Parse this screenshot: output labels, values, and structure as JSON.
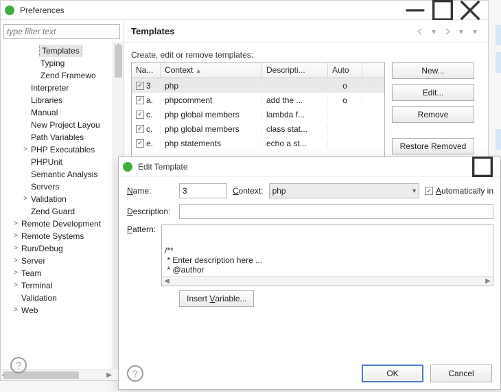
{
  "preferences": {
    "windowTitle": "Preferences",
    "filterPlaceholder": "type filter text",
    "tree": [
      {
        "label": "Templates",
        "level": 3,
        "selected": true
      },
      {
        "label": "Typing",
        "level": 3
      },
      {
        "label": "Zend Framewo",
        "level": 3
      },
      {
        "label": "Interpreter",
        "level": 2
      },
      {
        "label": "Libraries",
        "level": 2
      },
      {
        "label": "Manual",
        "level": 2
      },
      {
        "label": "New Project Layou",
        "level": 2
      },
      {
        "label": "Path Variables",
        "level": 2
      },
      {
        "label": "PHP Executables",
        "level": 2,
        "expander": ">"
      },
      {
        "label": "PHPUnit",
        "level": 2
      },
      {
        "label": "Semantic Analysis",
        "level": 2
      },
      {
        "label": "Servers",
        "level": 2
      },
      {
        "label": "Validation",
        "level": 2,
        "expander": ">"
      },
      {
        "label": "Zend Guard",
        "level": 2
      },
      {
        "label": "Remote Development",
        "level": 1,
        "expander": ">"
      },
      {
        "label": "Remote Systems",
        "level": 1,
        "expander": ">"
      },
      {
        "label": "Run/Debug",
        "level": 1,
        "expander": ">"
      },
      {
        "label": "Server",
        "level": 1,
        "expander": ">"
      },
      {
        "label": "Team",
        "level": 1,
        "expander": ">"
      },
      {
        "label": "Terminal",
        "level": 1,
        "expander": ">"
      },
      {
        "label": "Validation",
        "level": 1
      },
      {
        "label": "Web",
        "level": 1,
        "expander": ">"
      }
    ],
    "panel": {
      "title": "Templates",
      "description": "Create, edit or remove templates:",
      "columns": {
        "name": "Na...",
        "context": "Context",
        "descr": "Descripti...",
        "auto": "Auto"
      },
      "sortIndicator": "▲",
      "rows": [
        {
          "checked": true,
          "name": "3",
          "context": "php",
          "descr": "",
          "auto": "o",
          "selected": true
        },
        {
          "checked": true,
          "name": "a.",
          "context": "phpcomment",
          "descr": "add the ...",
          "auto": "o"
        },
        {
          "checked": true,
          "name": "c.",
          "context": "php global members",
          "descr": "lambda f...",
          "auto": ""
        },
        {
          "checked": true,
          "name": "c.",
          "context": "php global members",
          "descr": "class stat...",
          "auto": ""
        },
        {
          "checked": true,
          "name": "e.",
          "context": "php statements",
          "descr": "echo a st...",
          "auto": ""
        }
      ],
      "buttons": {
        "new": "New...",
        "edit": "Edit...",
        "remove": "Remove",
        "restoreRemoved": "Restore Removed"
      }
    }
  },
  "editTemplate": {
    "windowTitle": "Edit Template",
    "labels": {
      "name": "Name:",
      "context": "Context:",
      "auto": "Automatically in",
      "description": "Description:",
      "pattern": "Pattern:",
      "insertVar": "Insert Variable..."
    },
    "underline": {
      "name": "N",
      "context": "C",
      "auto": "A",
      "description": "D",
      "pattern": "P",
      "insertVar": "V"
    },
    "values": {
      "name": "3",
      "context": "php",
      "autoChecked": true,
      "description": "",
      "pattern": "/**\n * Enter description here ...\n * @author\n * @date ${date}${time}\n */"
    },
    "buttons": {
      "ok": "OK",
      "cancel": "Cancel"
    }
  }
}
